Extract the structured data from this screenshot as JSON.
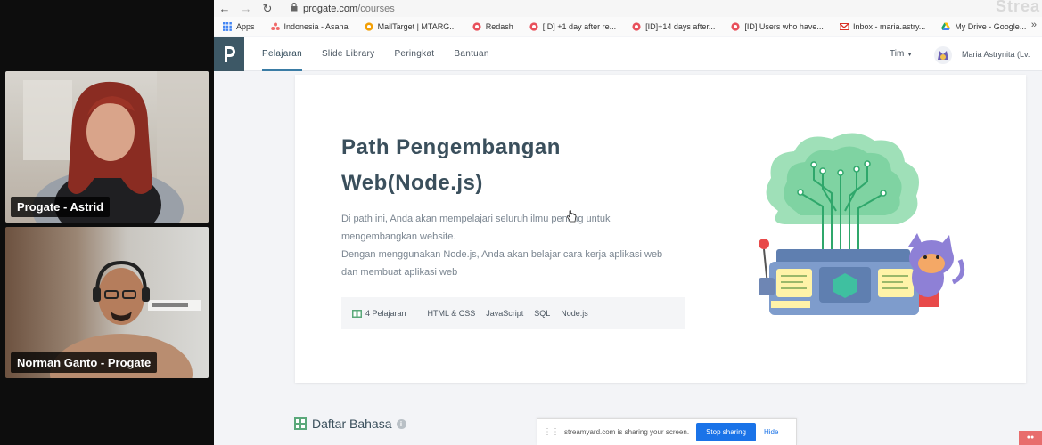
{
  "participants": [
    {
      "name": "Progate - Astrid"
    },
    {
      "name": "Norman Ganto - Progate"
    }
  ],
  "browser": {
    "url_main": "progate.com",
    "url_path": "/courses",
    "watermark": "Strea"
  },
  "bookmarks": [
    {
      "label": "Apps",
      "icon": "apps-grid-icon",
      "color": "#4285f4"
    },
    {
      "label": "Indonesia - Asana",
      "icon": "asana-icon",
      "color": "#f06a6a"
    },
    {
      "label": "MailTarget | MTARG...",
      "icon": "mailtarget-icon",
      "color": "#f29f05"
    },
    {
      "label": "Redash",
      "icon": "redash-icon",
      "color": "#e8505b"
    },
    {
      "label": "[ID] +1 day after re...",
      "icon": "redash-icon",
      "color": "#e8505b"
    },
    {
      "label": "[ID]+14 days after...",
      "icon": "redash-icon",
      "color": "#e8505b"
    },
    {
      "label": "[ID] Users who have...",
      "icon": "redash-icon",
      "color": "#e8505b"
    },
    {
      "label": "Inbox - maria.astry...",
      "icon": "gmail-icon",
      "color": "#d93025"
    },
    {
      "label": "My Drive - Google...",
      "icon": "drive-icon",
      "color": "#1fa463"
    }
  ],
  "site_nav": {
    "items": [
      "Pelajaran",
      "Slide Library",
      "Peringkat",
      "Bantuan"
    ],
    "active_index": 0,
    "team_label": "Tim",
    "user_name": "Maria Astrynita (Lv."
  },
  "course": {
    "title_line1": "Path Pengembangan",
    "title_line2": "Web(Node.js)",
    "desc_line1": "Di path ini, Anda akan mempelajari seluruh ilmu penting untuk",
    "desc_line2": "mengembangkan website.",
    "desc_line3": "Dengan menggunakan Node.js, Anda akan belajar cara kerja aplikasi web",
    "desc_line4": "dan membuat aplikasi web",
    "lesson_count": "4 Pelajaran",
    "tags": [
      "HTML & CSS",
      "JavaScript",
      "SQL",
      "Node.js"
    ]
  },
  "section": {
    "title": "Daftar Bahasa"
  },
  "share_bar": {
    "message": "streamyard.com is sharing your screen.",
    "stop_label": "Stop sharing",
    "hide_label": "Hide"
  },
  "colors": {
    "accent": "#3a7ca5",
    "logo_bg": "#3d5866",
    "stop_button": "#1a73e8"
  }
}
